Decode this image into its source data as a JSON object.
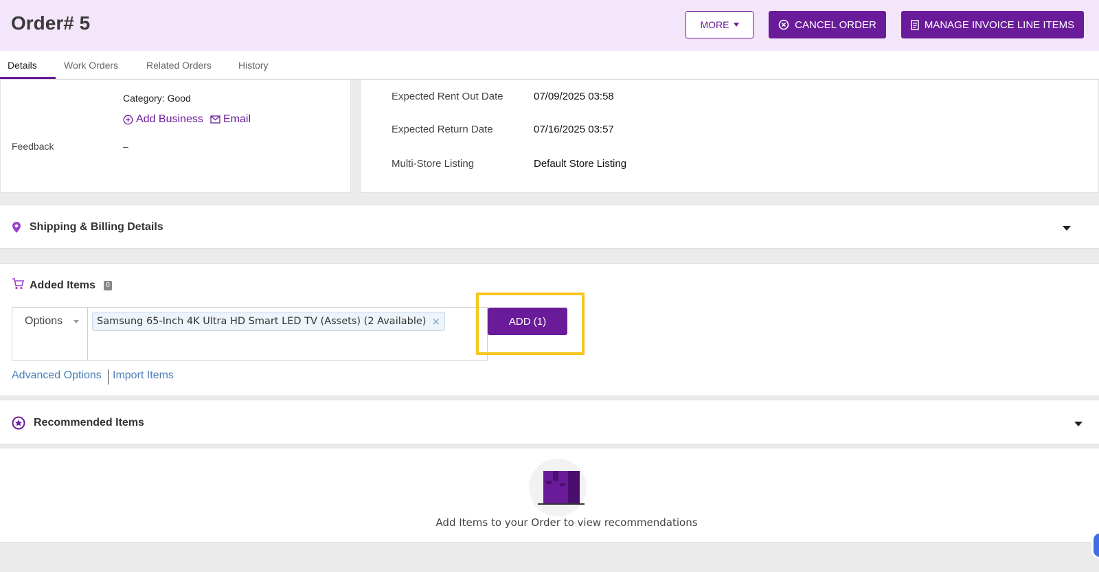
{
  "header": {
    "title": "Order# 5",
    "more_label": "MORE",
    "cancel_label": "CANCEL ORDER",
    "invoice_label": "MANAGE INVOICE LINE ITEMS"
  },
  "tabs": [
    {
      "label": "Details",
      "active": true
    },
    {
      "label": "Work Orders",
      "active": false
    },
    {
      "label": "Related Orders",
      "active": false
    },
    {
      "label": "History",
      "active": false
    }
  ],
  "customer": {
    "category": "Category: Good",
    "add_business": "Add Business",
    "email": "Email",
    "feedback_label": "Feedback",
    "feedback_value": "–"
  },
  "order_info": [
    {
      "label": "Expected Rent Out Date",
      "value": "07/09/2025 03:58"
    },
    {
      "label": "Expected Return Date",
      "value": "07/16/2025 03:57"
    },
    {
      "label": "Multi-Store Listing",
      "value": "Default Store Listing"
    }
  ],
  "shipping": {
    "title": "Shipping & Billing Details"
  },
  "added_items": {
    "title": "Added Items",
    "count": "0",
    "options_label": "Options",
    "selected_item": "Samsung 65-Inch 4K Ultra HD Smart LED TV (Assets) (2 Available)",
    "add_button": "ADD (1)",
    "advanced_options": "Advanced Options",
    "import_items": "Import Items"
  },
  "recommended": {
    "title": "Recommended Items",
    "empty_text": "Add Items to your Order to view recommendations"
  },
  "colors": {
    "brand": "#6a1b9a",
    "header_bg": "#f3e6fa",
    "highlight": "#f7c520",
    "link": "#4a7eb8"
  }
}
